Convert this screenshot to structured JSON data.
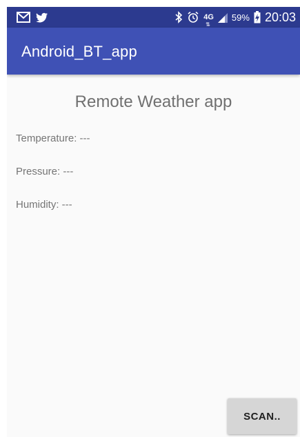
{
  "status_bar": {
    "left_icons": [
      "gmail-icon",
      "twitter-icon"
    ],
    "right_icons": [
      "bluetooth-icon",
      "alarm-icon",
      "signal-icon",
      "battery-icon"
    ],
    "network_type": "4G",
    "battery_percent": "59%",
    "time": "20:03"
  },
  "app_bar": {
    "title": "Android_BT_app"
  },
  "main": {
    "heading": "Remote Weather app",
    "temperature": "Temperature: ---",
    "pressure": "Pressure: ---",
    "humidity": "Humidity: ---",
    "scan_button_label": "SCAN.."
  },
  "colors": {
    "status_bar": "#2c3a8f",
    "app_bar": "#3f51b5",
    "background": "#fafafa",
    "button": "#d6d6d6"
  }
}
